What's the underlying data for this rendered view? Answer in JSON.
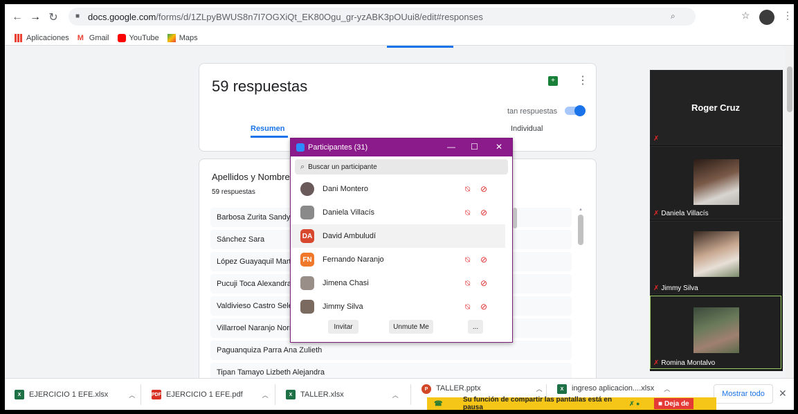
{
  "browser": {
    "url_host": "docs.google.com",
    "url_path": "/forms/d/1ZLpyBWUS8n7I7OGXiQt_EK80Ogu_gr-yzABK3pOUui8/edit#responses"
  },
  "bookmarks": [
    {
      "label": "Aplicaciones",
      "icon": "apps-grid-icon"
    },
    {
      "label": "Gmail",
      "icon": "gmail-icon"
    },
    {
      "label": "YouTube",
      "icon": "youtube-icon"
    },
    {
      "label": "Maps",
      "icon": "maps-icon"
    }
  ],
  "form": {
    "responses_title": "59 respuestas",
    "accepting_label": "tan respuestas",
    "accepting_on": true,
    "tab_summary": "Resumen",
    "tab_individual": "Individual",
    "question_title": "Apellidos y Nombres",
    "question_count": "59 respuestas",
    "answers": [
      "Barbosa Zurita Sandy C",
      "Sánchez Sara",
      "López Guayaquil Marth",
      "Pucuji Toca Alexandra",
      "Valdivieso Castro Selene Fernanda",
      "Villarroel Naranjo Norma Katherine",
      "Paguanquiza Parra Ana Zulieth",
      "Tipan Tamayo Lizbeth Alejandra"
    ]
  },
  "participants": {
    "title": "Participantes (31)",
    "search_placeholder": "Buscar un participante",
    "list": [
      {
        "name": "Dani Montero",
        "initials": "",
        "color": "#6a5a5a"
      },
      {
        "name": "Daniela Villacís",
        "initials": "",
        "color": "#8a8a8a"
      },
      {
        "name": "David  Ambuludí",
        "initials": "DA",
        "color": "#d7482f"
      },
      {
        "name": "Fernando Naranjo",
        "initials": "FN",
        "color": "#f0782a"
      },
      {
        "name": "Jimena Chasi",
        "initials": "",
        "color": "#9a8f88"
      },
      {
        "name": "Jimmy Silva",
        "initials": "",
        "color": "#7a6a60"
      }
    ],
    "invite_label": "Invitar",
    "unmute_label": "Unmute Me",
    "more_label": "..."
  },
  "video_panel": {
    "speaker": "Roger Cruz",
    "tiles": [
      "Daniela Villacís",
      "Jimmy Silva",
      "Romina Montalvo"
    ]
  },
  "downloads": [
    {
      "name": "EJERCICIO 1 EFE.xlsx",
      "type": "xlsx",
      "color": "#1e7145"
    },
    {
      "name": "EJERCICIO 1 EFE.pdf",
      "type": "pdf",
      "color": "#d93025"
    },
    {
      "name": "TALLER.xlsx",
      "type": "xlsx",
      "color": "#1e7145"
    },
    {
      "name": "TALLER.pptx",
      "type": "pptx",
      "color": "#d24726"
    },
    {
      "name": "ingreso aplicacion....xlsx",
      "type": "xlsx",
      "color": "#1e7145"
    }
  ],
  "show_all_label": "Mostrar todo",
  "share_notice": "Su función de compartir las pantallas está en pausa",
  "stop_label": "Deja de"
}
